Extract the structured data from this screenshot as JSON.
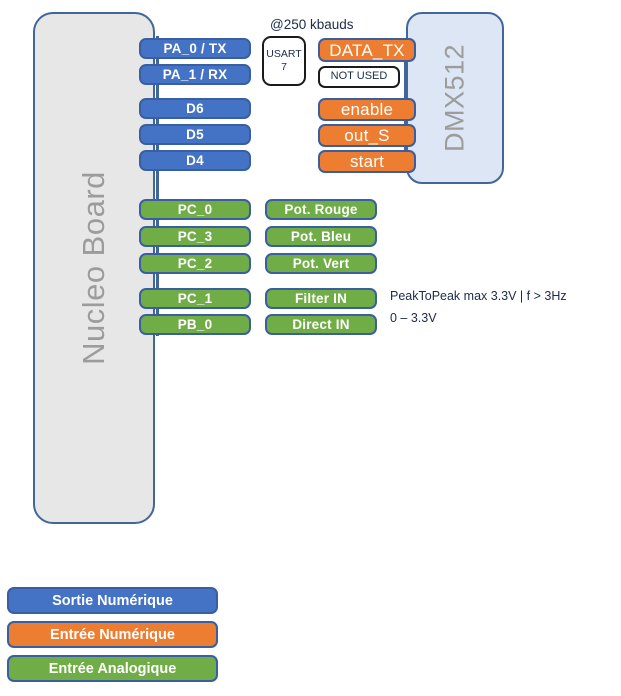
{
  "diagram": {
    "boards": {
      "nucleo": {
        "label": "Nucleo Board"
      },
      "dmx": {
        "label": "DMX512"
      }
    },
    "notes": {
      "baud": "@250 kbauds",
      "peak_to_peak": "PeakToPeak max 3.3V | f > 3Hz",
      "range": "0 – 3.3V"
    },
    "boxes": {
      "usart_line1": "USART",
      "usart_line2": "7",
      "not_used": "NOT USED"
    },
    "mcu_pins": [
      {
        "label": "PA_0 / TX",
        "type": "digital-output"
      },
      {
        "label": "PA_1 / RX",
        "type": "digital-output"
      },
      {
        "label": "D6",
        "type": "digital-output"
      },
      {
        "label": "D5",
        "type": "digital-output"
      },
      {
        "label": "D4",
        "type": "digital-output"
      },
      {
        "label": "PC_0",
        "type": "analog-input"
      },
      {
        "label": "PC_3",
        "type": "analog-input"
      },
      {
        "label": "PC_2",
        "type": "analog-input"
      },
      {
        "label": "PC_1",
        "type": "analog-input"
      },
      {
        "label": "PB_0",
        "type": "analog-input"
      }
    ],
    "peripheral_signals": [
      {
        "label": "DATA_TX",
        "type": "digital-input"
      },
      {
        "label": "enable",
        "type": "digital-input"
      },
      {
        "label": "out_S",
        "type": "digital-input"
      },
      {
        "label": "start",
        "type": "digital-input"
      },
      {
        "label": "Pot. Rouge",
        "type": "analog-input"
      },
      {
        "label": "Pot. Bleu",
        "type": "analog-input"
      },
      {
        "label": "Pot. Vert",
        "type": "analog-input"
      },
      {
        "label": "Filter IN",
        "type": "analog-input"
      },
      {
        "label": "Direct IN",
        "type": "analog-input"
      }
    ],
    "legend": [
      {
        "label": "Sortie Numérique",
        "color": "#4472C4"
      },
      {
        "label": "Entrée Numérique",
        "color": "#ED7D31"
      },
      {
        "label": "Entrée Analogique",
        "color": "#70AD47"
      }
    ],
    "colors": {
      "digital_output": "#4472C4",
      "digital_input": "#ED7D31",
      "analog_input": "#70AD47",
      "border": "#3A5FA0",
      "nucleo_fill": "#E7E7E7",
      "dmx_fill": "#DCE6F4"
    }
  }
}
